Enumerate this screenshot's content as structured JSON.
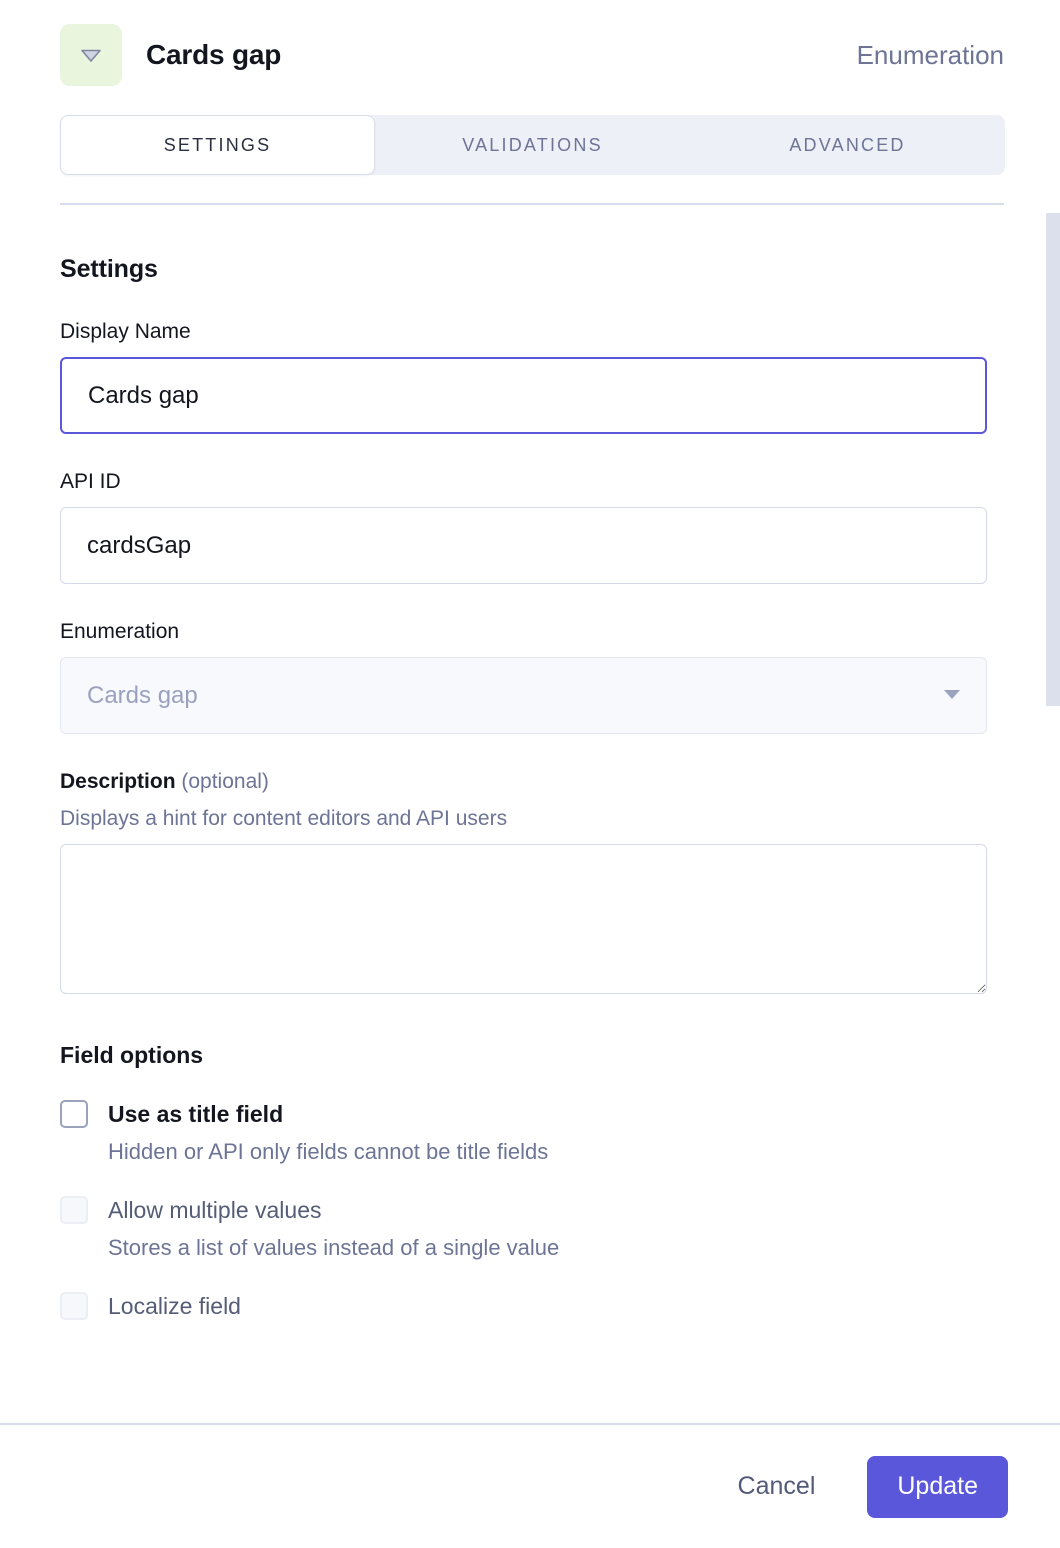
{
  "header": {
    "icon": "caret-down-enumeration-icon",
    "icon_bg": "#e9f5dd",
    "title": "Cards gap",
    "type_label": "Enumeration"
  },
  "tabs": [
    {
      "label": "SETTINGS",
      "active": true
    },
    {
      "label": "VALIDATIONS",
      "active": false
    },
    {
      "label": "ADVANCED",
      "active": false
    }
  ],
  "settings": {
    "section_title": "Settings",
    "display_name": {
      "label": "Display Name",
      "value": "Cards gap",
      "placeholder": ""
    },
    "api_id": {
      "label": "API ID",
      "value": "cardsGap",
      "placeholder": ""
    },
    "enumeration": {
      "label": "Enumeration",
      "value": "Cards gap",
      "arrow_icon": "chevron-down-icon"
    },
    "description": {
      "label": "Description",
      "optional": "(optional)",
      "hint": "Displays a hint for content editors and API users",
      "value": "",
      "placeholder": ""
    }
  },
  "field_options": {
    "title": "Field options",
    "items": [
      {
        "label": "Use as title field",
        "description": "Hidden or API only fields cannot be title fields",
        "checked": false,
        "disabled": false
      },
      {
        "label": "Allow multiple values",
        "description": "Stores a list of values instead of a single value",
        "checked": false,
        "disabled": true
      },
      {
        "label": "Localize field",
        "description": "",
        "checked": false,
        "disabled": true
      }
    ]
  },
  "footer": {
    "cancel_label": "Cancel",
    "update_label": "Update",
    "accent_color": "#5b57db"
  }
}
